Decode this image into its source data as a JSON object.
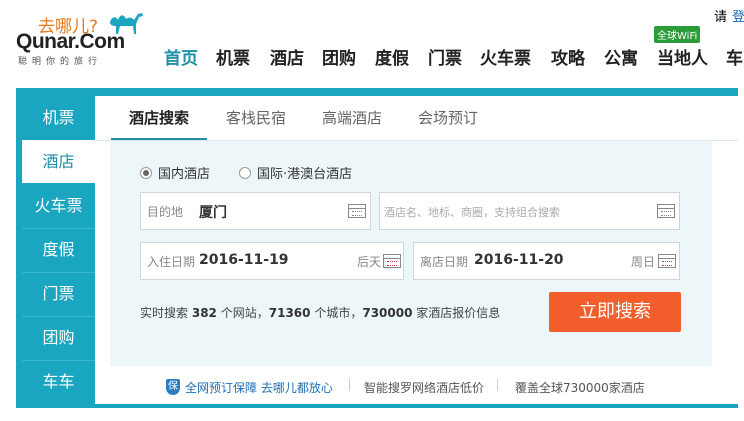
{
  "logo": {
    "cn": "去哪儿?",
    "en": "Qunar.Com",
    "sub": "聪明你的旅行"
  },
  "header": {
    "top_right": "请",
    "login": "登",
    "wifi_badge": "全球WiFi"
  },
  "nav": [
    "首页",
    "机票",
    "酒店",
    "团购",
    "度假",
    "门票",
    "火车票",
    "攻略",
    "公寓",
    "当地人",
    "车"
  ],
  "sidebar": [
    "机票",
    "酒店",
    "火车票",
    "度假",
    "门票",
    "团购",
    "车车"
  ],
  "tabs": [
    "酒店搜索",
    "客栈民宿",
    "高端酒店",
    "会场预订"
  ],
  "radios": {
    "domestic": "国内酒店",
    "intl": "国际·港澳台酒店"
  },
  "form": {
    "dest_label": "目的地",
    "dest_value": "厦门",
    "keyword_placeholder": "酒店名、地标、商圈，支持组合搜索",
    "checkin_label": "入住日期",
    "checkin_value": "2016-11-19",
    "checkin_suffix": "后天",
    "checkout_label": "离店日期",
    "checkout_value": "2016-11-20",
    "checkout_suffix": "周日"
  },
  "stats": {
    "prefix": "实时搜索",
    "sites": "382",
    "sites_unit": "个网站，",
    "cities": "71360",
    "cities_unit": "个城市，",
    "hotels": "730000",
    "hotels_unit": "家酒店报价信息"
  },
  "search_button": "立即搜索",
  "footer": {
    "guard": "全网预订保障 去哪儿都放心",
    "smart": "智能搜罗网络酒店低价",
    "cover": "覆盖全球730000家酒店"
  },
  "colors": {
    "accent": "#1aa6c0",
    "button": "#f25f2c",
    "brand_orange": "#e8791b"
  }
}
